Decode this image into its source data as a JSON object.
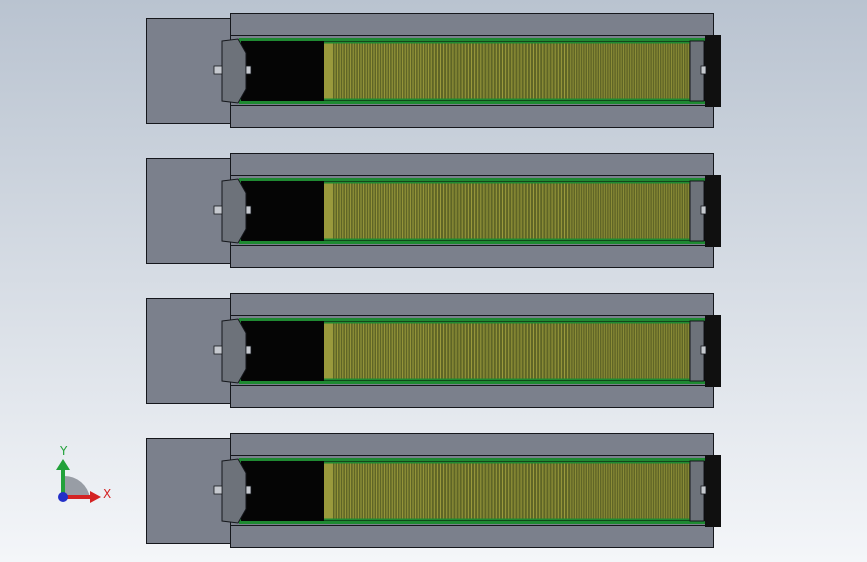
{
  "view": {
    "background_top": "#b9c3d0",
    "background_bottom": "#f4f6f9"
  },
  "assembly": {
    "unit_count": 4,
    "colors": {
      "housing": "#7b808c",
      "housing_edge": "#15171c",
      "cavity": "#050505",
      "frame_green": "#1f8a32",
      "fin_olive": "#9a9a3c",
      "fin_dark": "#5f6526",
      "fin_dense": "#8c8d37",
      "end_cap": "#101010",
      "bracket": "#6d727a",
      "stud": "#c6c9cf"
    }
  },
  "triad": {
    "x_label": "X",
    "y_label": "Y",
    "x_color": "#d42323",
    "y_color": "#22a13a",
    "z_color": "#2330c8",
    "arc_color": "#8f949c"
  }
}
